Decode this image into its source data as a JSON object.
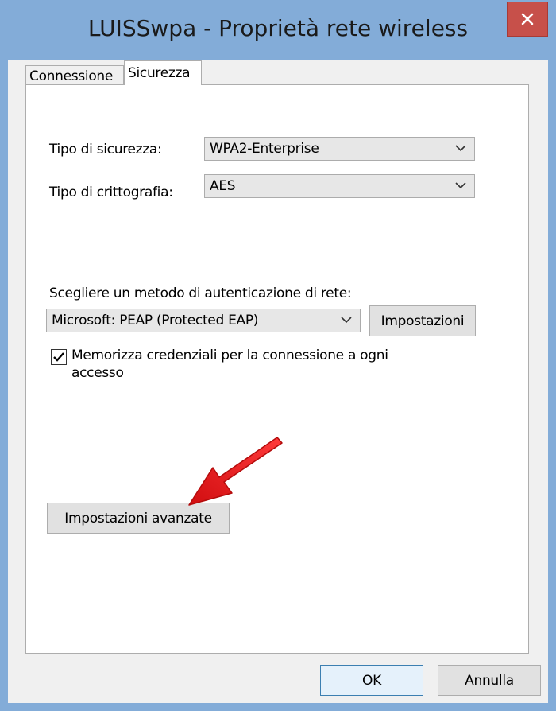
{
  "window": {
    "title": "LUISSwpa - Proprietà rete wireless"
  },
  "tabs": [
    {
      "label": "Connessione",
      "active": false
    },
    {
      "label": "Sicurezza",
      "active": true
    }
  ],
  "security": {
    "type_label": "Tipo di sicurezza:",
    "type_value": "WPA2-Enterprise",
    "encryption_label": "Tipo di crittografia:",
    "encryption_value": "AES"
  },
  "auth": {
    "method_label": "Scegliere un metodo di autenticazione di rete:",
    "method_value": "Microsoft: PEAP (Protected EAP)",
    "settings_button": "Impostazioni",
    "remember_line1": "Memorizza credenziali per la connessione a ogni",
    "remember_line2": "accesso",
    "remember_checked": true
  },
  "advanced_button": "Impostazioni avanzate",
  "footer": {
    "ok": "OK",
    "cancel": "Annulla"
  },
  "colors": {
    "titlebar": "#83acd8",
    "close": "#c7504a",
    "annotation_arrow": "#e3171a"
  },
  "icons": [
    "close-icon",
    "chevron-down-icon",
    "checkmark-icon",
    "annotation-arrow-icon"
  ]
}
